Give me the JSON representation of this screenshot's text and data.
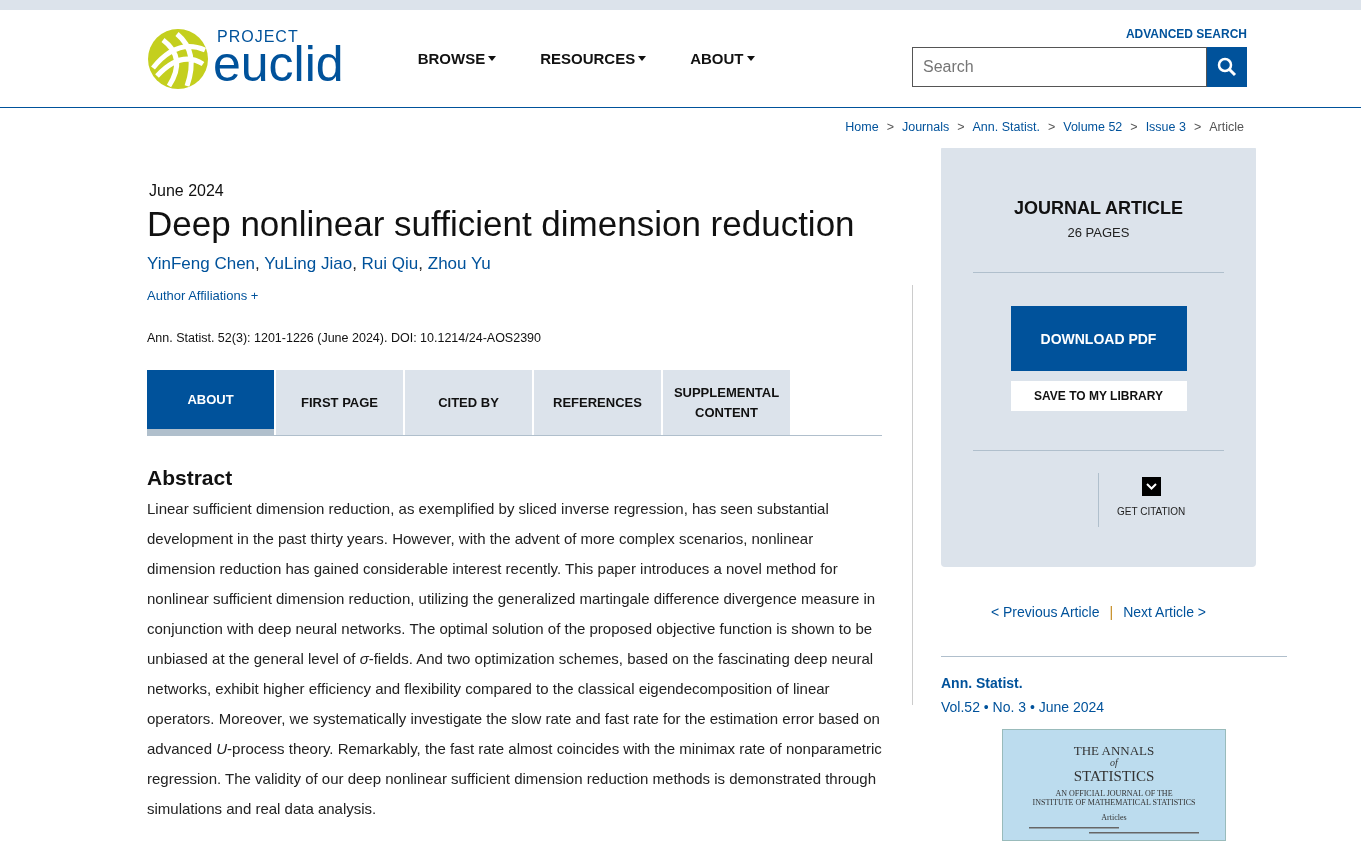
{
  "header": {
    "logo": {
      "top": "PROJECT",
      "bottom": "euclid"
    },
    "nav": [
      {
        "label": "BROWSE"
      },
      {
        "label": "RESOURCES"
      },
      {
        "label": "ABOUT"
      }
    ],
    "advanced_search": "ADVANCED SEARCH",
    "search": {
      "placeholder": "Search"
    }
  },
  "breadcrumb": [
    {
      "kind": "link",
      "label": "Home"
    },
    {
      "kind": "separator",
      "label": ">"
    },
    {
      "kind": "link",
      "label": "Journals"
    },
    {
      "kind": "separator",
      "label": ">"
    },
    {
      "kind": "link",
      "label": "Ann. Statist."
    },
    {
      "kind": "separator",
      "label": ">"
    },
    {
      "kind": "link",
      "label": "Volume 52"
    },
    {
      "kind": "separator",
      "label": ">"
    },
    {
      "kind": "link",
      "label": "Issue 3"
    },
    {
      "kind": "separator",
      "label": ">"
    },
    {
      "kind": "current",
      "label": "Article"
    }
  ],
  "article": {
    "date": "June 2024",
    "title": "Deep nonlinear sufficient dimension reduction",
    "authors": [
      {
        "name": "YinFeng Chen",
        "separator": ","
      },
      {
        "name": "YuLing Jiao",
        "separator": ","
      },
      {
        "name": "Rui Qiu",
        "separator": ","
      },
      {
        "name": "Zhou Yu"
      }
    ],
    "affiliations": "Author Affiliations +",
    "citation": "Ann. Statist. 52(3): 1201-1226 (June 2024). DOI: 10.1214/24-AOS2390",
    "tabs": [
      {
        "label": "ABOUT",
        "selected": true
      },
      {
        "label": "FIRST PAGE",
        "selected": false
      },
      {
        "label": "CITED BY",
        "selected": false
      },
      {
        "label": "REFERENCES",
        "selected": false
      },
      {
        "label": "SUPPLEMENTAL CONTENT",
        "selected": false
      }
    ],
    "abstract_heading": "Abstract",
    "abstract": "Linear sufficient dimension reduction, as exemplified by sliced inverse regression, has seen substantial development in the past thirty years. However, with the advent of more complex scenarios, nonlinear dimension reduction has gained considerable interest recently. This paper introduces a novel method for nonlinear sufficient dimension reduction, utilizing the generalized martingale difference divergence measure in conjunction with deep neural networks. The optimal solution of the proposed objective function is shown to be unbiased at the general level of *σ*-fields. And two optimization schemes, based on the fascinating deep neural networks, exhibit higher efficiency and flexibility compared to the classical eigendecomposition of linear operators. Moreover, we systematically investigate the slow rate and fast rate for the estimation error based on advanced *U*-process theory. Remarkably, the fast rate almost coincides with the minimax rate of nonparametric regression. The validity of our deep nonlinear sufficient dimension reduction methods is demonstrated through simulations and real data analysis."
  },
  "sidebar": {
    "type": "JOURNAL ARTICLE",
    "pages": "26 PAGES",
    "download": "DOWNLOAD PDF",
    "save": "SAVE TO MY LIBRARY",
    "citation": "GET CITATION",
    "prev": "< Previous Article",
    "separator": "|",
    "next": "Next Article >",
    "journal": "Ann. Statist.",
    "issue": "Vol.52 • No. 3 • June 2024",
    "cover": {
      "title": "THE ANNALS",
      "of": "of",
      "subject": "STATISTICS",
      "subtitle_1": "AN OFFICIAL JOURNAL OF THE",
      "subtitle_2": "INSTITUTE OF MATHEMATICAL STATISTICS",
      "section": "Articles"
    }
  }
}
